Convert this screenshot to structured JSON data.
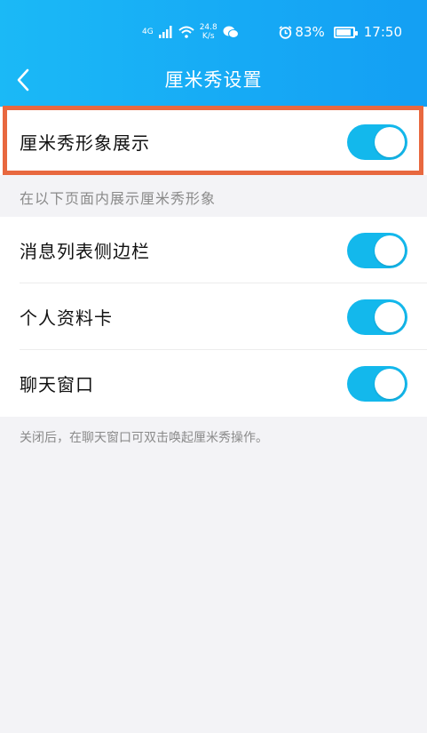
{
  "status_bar": {
    "network": "4G",
    "speed_value": "24.8",
    "speed_unit": "K/s",
    "battery_percent": "83%",
    "time": "17:50",
    "icons": [
      "signal-icon",
      "wifi-icon",
      "wechat-icon",
      "alarm-icon",
      "battery-icon"
    ]
  },
  "nav": {
    "title": "厘米秀设置",
    "back_icon": "chevron-left-icon"
  },
  "main_toggle": {
    "label": "厘米秀形象展示",
    "on": true
  },
  "section_note": "在以下页面内展示厘米秀形象",
  "settings": [
    {
      "label": "消息列表侧边栏",
      "on": true
    },
    {
      "label": "个人资料卡",
      "on": true
    },
    {
      "label": "聊天窗口",
      "on": true
    }
  ],
  "footer_note": "关闭后，在聊天窗口可双击唤起厘米秀操作。",
  "colors": {
    "header_start": "#1bb9f6",
    "header_end": "#149ff3",
    "toggle_on": "#13b8ec",
    "highlight": "#e8683f",
    "background": "#f3f3f6"
  }
}
